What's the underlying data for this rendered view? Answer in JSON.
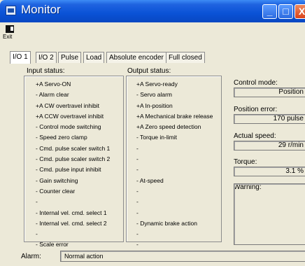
{
  "window": {
    "title": "Monitor",
    "buttons": {
      "minimize": "_",
      "maximize": "□",
      "close": "X"
    }
  },
  "toolbar": {
    "exit_label": "Exit"
  },
  "tabs": [
    {
      "label": "I/O 1",
      "active": true
    },
    {
      "label": "I/O 2"
    },
    {
      "label": "Pulse"
    },
    {
      "label": "Load"
    },
    {
      "label": "Absolute encoder"
    },
    {
      "label": "Full closed"
    }
  ],
  "input_status": {
    "label": "Input status:",
    "items": [
      "+A Servo-ON",
      "-   Alarm clear",
      "+A CW overtravel inhibit",
      "+A CCW overtravel inhibit",
      "-   Control mode switching",
      "-   Speed zero clamp",
      "-   Cmd. pulse scaler switch 1",
      "-   Cmd. pulse scaler switch 2",
      "-   Cmd. pulse input inhibit",
      "-   Gain switching",
      "-   Counter clear",
      "-",
      "-   Internal vel. cmd. select 1",
      "-   Internal vel. cmd. select 2",
      "-",
      "-   Scale error"
    ]
  },
  "output_status": {
    "label": "Output status:",
    "items": [
      "+A Servo-ready",
      "-   Servo alarm",
      "+A In-position",
      "+A Mechanical brake release",
      "+A Zero speed detection",
      "-   Torque in-limit",
      "-",
      "-",
      "-",
      "-   At-speed",
      "-",
      "-",
      "-",
      "-   Dynamic brake action",
      "-",
      "-"
    ]
  },
  "right_panel": {
    "control_mode_label": "Control mode:",
    "control_mode_value": "Position",
    "position_error_label": "Position error:",
    "position_error_value": "170 pulse",
    "actual_speed_label": "Actual speed:",
    "actual_speed_value": "29 r/min",
    "torque_label": "Torque:",
    "torque_value": "3.1 %",
    "warning_label": "Warning:"
  },
  "alarm": {
    "label": "Alarm:",
    "value": "Normal action"
  }
}
